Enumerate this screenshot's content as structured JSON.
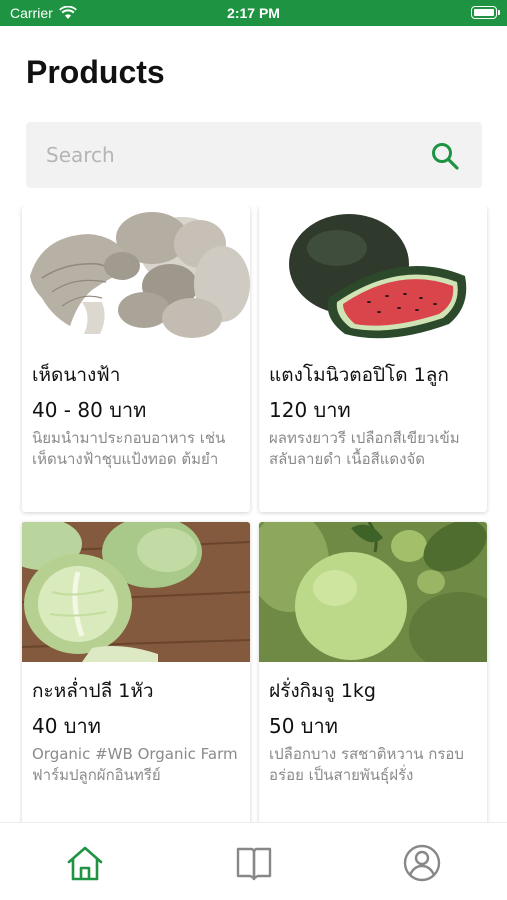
{
  "status_bar": {
    "carrier": "Carrier",
    "time": "2:17 PM",
    "color": "#1e9442"
  },
  "header": {
    "title": "Products"
  },
  "search": {
    "placeholder": "Search",
    "value": "",
    "icon": "search-icon"
  },
  "products": [
    {
      "name": "เห็ดนางฟ้า",
      "price": "40 - 80 บาท",
      "description": "นิยมนำมาประกอบอาหาร เช่น เห็ดนางฟ้าชุบแป้งทอด ต้มยำ",
      "image": "oyster-mushroom-image"
    },
    {
      "name": "แตงโมนิวตอปิโด 1ลูก",
      "price": "120 บาท",
      "description": "ผลทรงยาวรี เปลือกสีเขียวเข้มสลับลายดำ เนื้อสีแดงจัด",
      "image": "watermelon-image"
    },
    {
      "name": "กะหล่ำปลี 1หัว",
      "price": "40 บาท",
      "description": "Organic #WB Organic Farm ฟาร์มปลูกผักอินทรีย์",
      "image": "cabbage-image"
    },
    {
      "name": "ฝรั่งกิมจู 1kg",
      "price": "50 บาท",
      "description": "เปลือกบาง รสชาติหวาน กรอบอร่อย เป็นสายพันธุ์ฝรั่ง",
      "image": "guava-image"
    }
  ],
  "tab_bar": {
    "items": [
      {
        "icon": "home-icon",
        "active": true
      },
      {
        "icon": "book-icon",
        "active": false
      },
      {
        "icon": "profile-icon",
        "active": false
      }
    ],
    "active_color": "#1e9442",
    "inactive_color": "#888888"
  }
}
